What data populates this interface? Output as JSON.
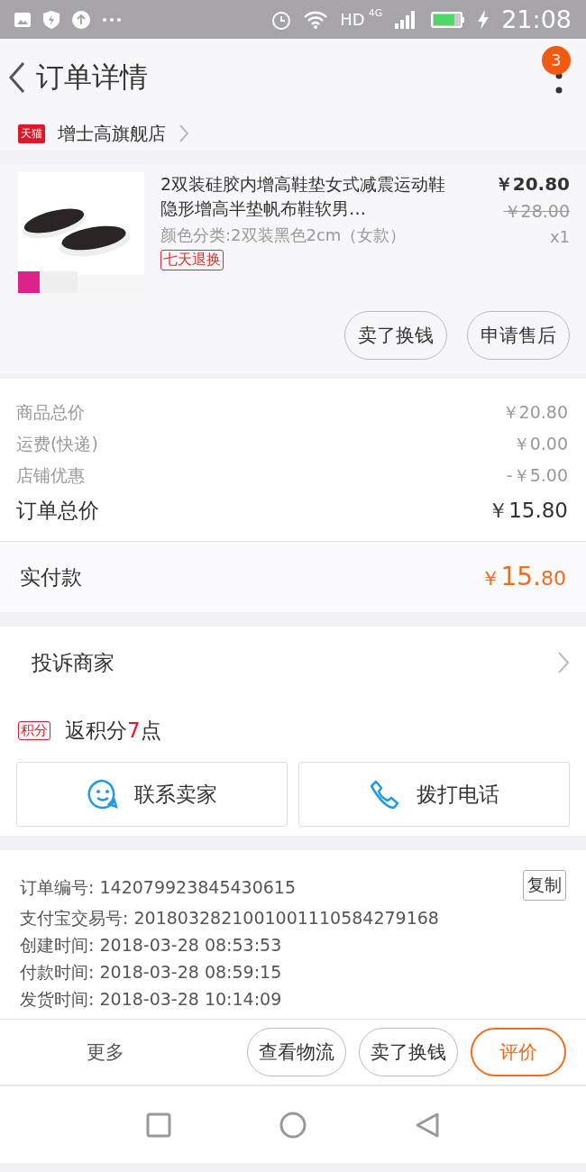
{
  "status_bar": {
    "hd": "HD",
    "network": "4G",
    "time": "21:08"
  },
  "header": {
    "title": "订单详情",
    "badge": "3"
  },
  "store": {
    "logo": "天猫",
    "name": "增士高旗舰店"
  },
  "product": {
    "kind": "picture",
    "title": "2双装硅胶内增高鞋垫女式减震运动鞋隐形增高半垫帆布鞋软男…",
    "variant": "颜色分类:2双装黑色2cm（女款）",
    "tag": "七天退换",
    "price": "￥20.80",
    "original_price": "￥28.00",
    "quantity": "x1",
    "actions": [
      "卖了换钱",
      "申请售后"
    ]
  },
  "summary": [
    {
      "label": "商品总价",
      "value": "￥20.80",
      "kind": "line"
    },
    {
      "label": "运费(快递)",
      "value": "￥0.00",
      "kind": "line"
    },
    {
      "label": "店铺优惠",
      "value": "-￥5.00",
      "kind": "line"
    },
    {
      "label": "订单总价",
      "value": "￥15.80",
      "kind": "total"
    }
  ],
  "paid": {
    "label": "实付款",
    "currency": "￥",
    "integer": "15.",
    "decimal": "80"
  },
  "complaint": {
    "label": "投诉商家"
  },
  "points": {
    "badge": "积分",
    "text": "返积分",
    "count": "7",
    "unit": "点"
  },
  "contact": [
    {
      "label": "联系卖家",
      "kind": "chat"
    },
    {
      "label": "拨打电话",
      "kind": "phone"
    }
  ],
  "order_info": {
    "copy_button": "复制",
    "lines": [
      {
        "label": "订单编号:",
        "value": "142079923845430615"
      },
      {
        "label": "支付宝交易号:",
        "value": "2018032821001001110584279168"
      },
      {
        "label": "创建时间:",
        "value": "2018-03-28 08:53:53"
      },
      {
        "label": "付款时间:",
        "value": "2018-03-28 08:59:15"
      },
      {
        "label": "发货时间:",
        "value": "2018-03-28 10:14:09"
      }
    ]
  },
  "bottom_bar": {
    "more": "更多",
    "buttons": [
      {
        "label": "查看物流",
        "primary": false
      },
      {
        "label": "卖了换钱",
        "primary": false
      },
      {
        "label": "评价",
        "primary": true
      }
    ]
  }
}
